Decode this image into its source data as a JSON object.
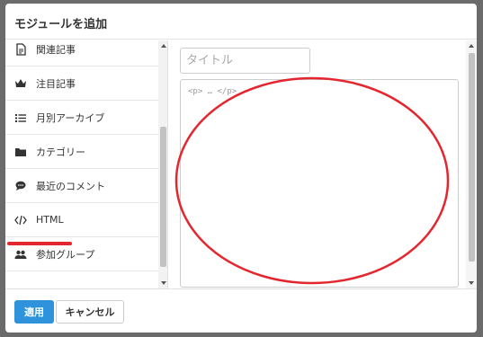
{
  "modal": {
    "title": "モジュールを追加"
  },
  "modules": [
    {
      "label": "関連記事",
      "icon": "document-icon"
    },
    {
      "label": "注目記事",
      "icon": "crown-icon"
    },
    {
      "label": "月別アーカイブ",
      "icon": "list-icon"
    },
    {
      "label": "カテゴリー",
      "icon": "folder-icon"
    },
    {
      "label": "最近のコメント",
      "icon": "comment-icon"
    },
    {
      "label": "HTML",
      "icon": "code-icon"
    },
    {
      "label": "参加グループ",
      "icon": "users-icon"
    }
  ],
  "editor": {
    "title_placeholder": "タイトル",
    "html_placeholder": "<p> … </p>"
  },
  "footer": {
    "apply_label": "適用",
    "cancel_label": "キャンセル"
  },
  "annotation": {
    "color": "#e4262f",
    "highlighted_item": "HTML"
  }
}
